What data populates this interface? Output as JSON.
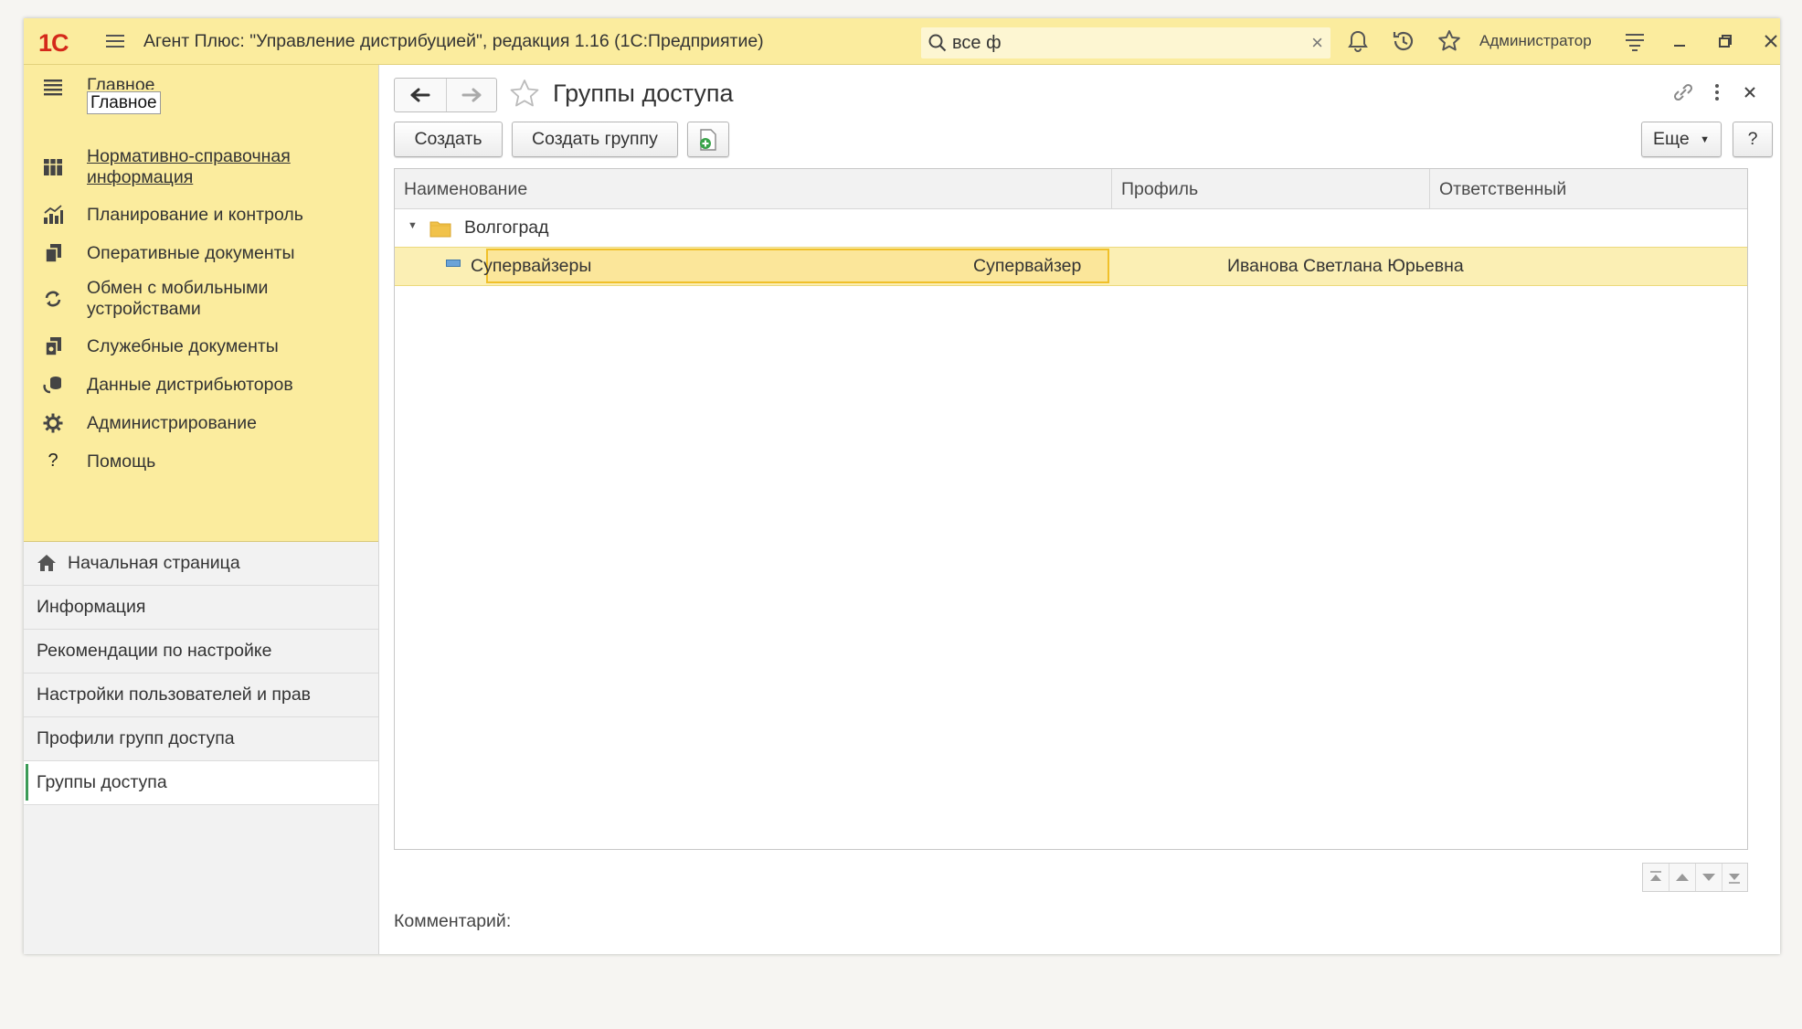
{
  "titlebar": {
    "logo": "1С",
    "title": "Агент Плюс: \"Управление дистрибуцией\", редакция 1.16  (1С:Предприятие)",
    "search_value": "все ф",
    "user": "Администратор"
  },
  "sections": {
    "tooltip": "Главное",
    "items": [
      {
        "label": "Главное",
        "icon": "menu-lines-icon"
      },
      {
        "label": "Нормативно-справочная информация",
        "icon": "catalog-grid-icon"
      },
      {
        "label": "Планирование и контроль",
        "icon": "bar-chart-icon"
      },
      {
        "label": "Оперативные документы",
        "icon": "documents-icon"
      },
      {
        "label": "Обмен с мобильными устройствами",
        "icon": "sync-icon"
      },
      {
        "label": "Служебные документы",
        "icon": "service-docs-icon"
      },
      {
        "label": "Данные дистрибьюторов",
        "icon": "distributor-data-icon"
      },
      {
        "label": "Администрирование",
        "icon": "gear-icon"
      },
      {
        "label": "Помощь",
        "icon": "question-icon"
      }
    ]
  },
  "nav": {
    "items": [
      {
        "label": "Начальная страница"
      },
      {
        "label": "Информация"
      },
      {
        "label": "Рекомендации по настройке"
      },
      {
        "label": "Настройки пользователей и прав"
      },
      {
        "label": "Профили групп доступа"
      },
      {
        "label": "Группы доступа"
      }
    ]
  },
  "form": {
    "title": "Группы доступа",
    "buttons": {
      "create": "Создать",
      "create_group": "Создать группу",
      "more": "Еще",
      "help": "?"
    },
    "columns": [
      "Наименование",
      "Профиль",
      "Ответственный"
    ],
    "group_row": {
      "name": "Волгоград"
    },
    "rows": [
      {
        "name": "Супервайзеры",
        "profile": "Супервайзер",
        "responsible": "Иванова Светлана Юрьевна"
      }
    ],
    "comment_label": "Комментарий:"
  },
  "colors": {
    "accent_yellow": "#fbec9e",
    "selection": "#fbefb4",
    "active_marker": "#3a9b56"
  }
}
